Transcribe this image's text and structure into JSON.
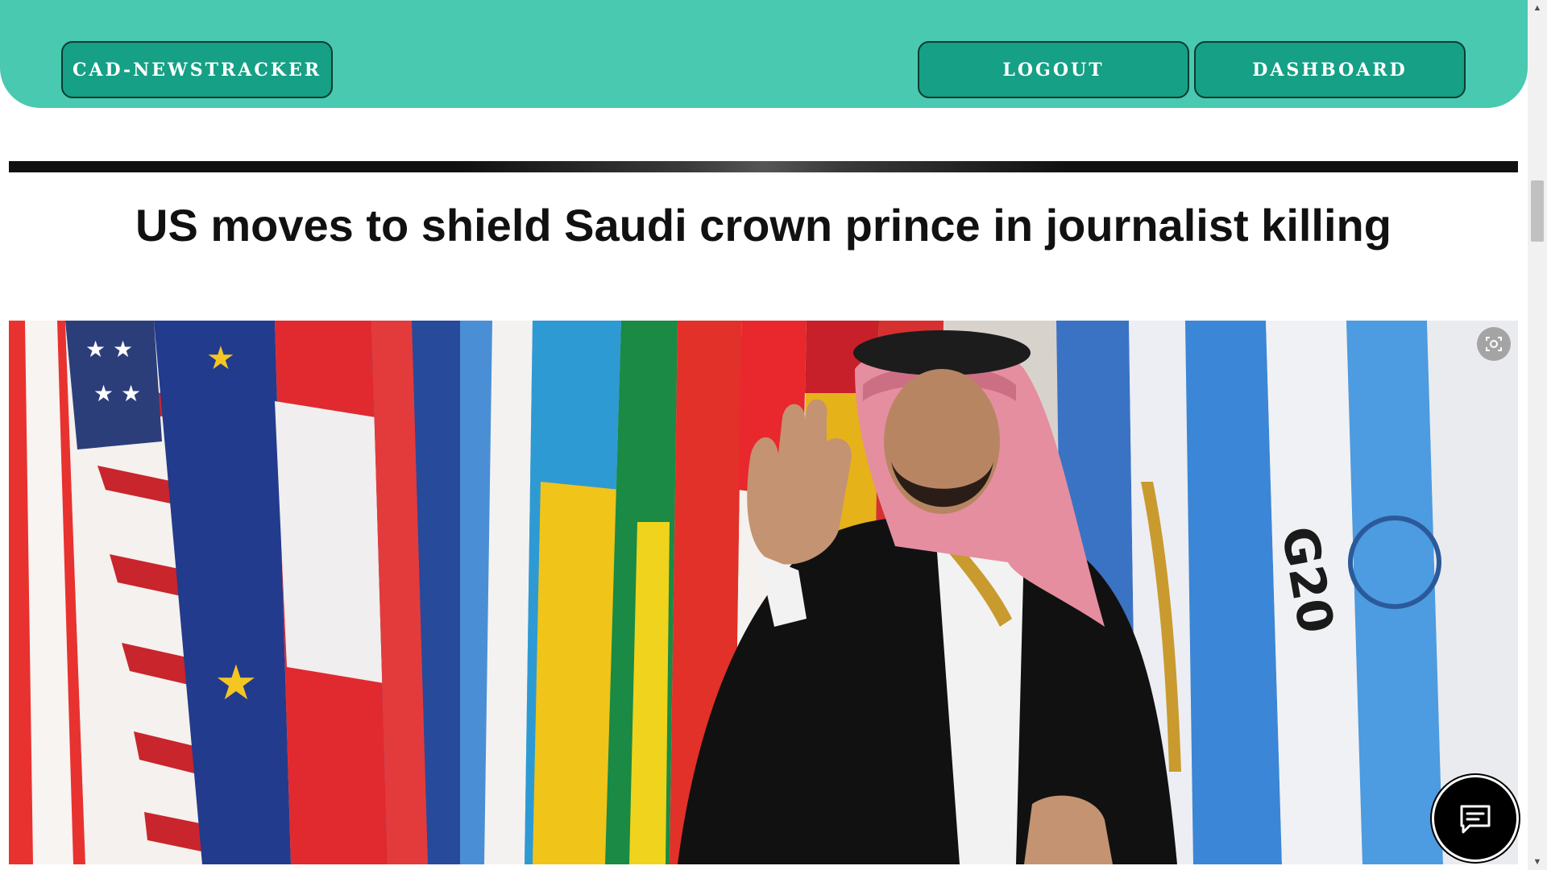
{
  "navbar": {
    "brand_label": "CAD-NEWSTRACKER",
    "logout_label": "LOGOUT",
    "dashboard_label": "DASHBOARD",
    "background_color": "#48c9b0",
    "button_color": "#16a085"
  },
  "article": {
    "headline": "US moves to shield Saudi crown prince in journalist killing",
    "image_alt": "Saudi crown prince waving in front of a row of national flags"
  },
  "icons": {
    "lens": "visual-search-icon",
    "chat": "chat-bubble-icon",
    "scroll_up": "arrow-up-icon",
    "scroll_down": "arrow-down-icon"
  }
}
